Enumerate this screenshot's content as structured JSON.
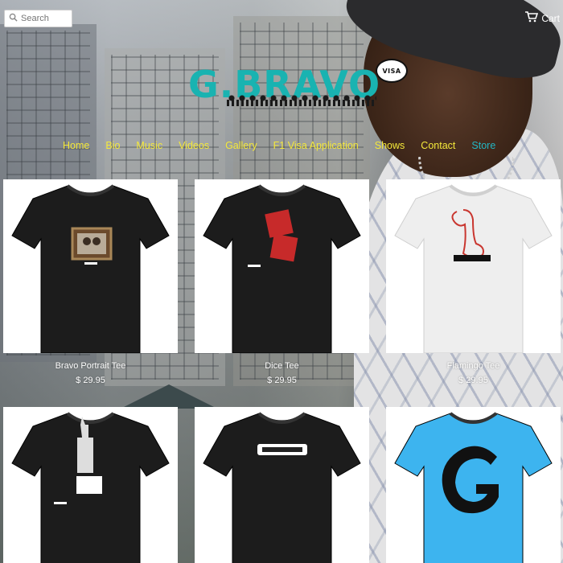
{
  "header": {
    "search_placeholder": "Search",
    "cart_label": "Cart",
    "logo_text": "G.BRAVO",
    "badge_text": "VISA"
  },
  "nav": [
    {
      "label": "Home"
    },
    {
      "label": "Bio"
    },
    {
      "label": "Music"
    },
    {
      "label": "Videos"
    },
    {
      "label": "Gallery"
    },
    {
      "label": "F1 Visa Application"
    },
    {
      "label": "Shows"
    },
    {
      "label": "Contact"
    },
    {
      "label": "Store",
      "active": true
    }
  ],
  "products": [
    {
      "name": "Bravo Portrait Tee",
      "price": "$ 29.95",
      "shirt_color": "#1c1c1c",
      "design": "portrait"
    },
    {
      "name": "Dice Tee",
      "price": "$ 29.95",
      "shirt_color": "#1c1c1c",
      "design": "dice"
    },
    {
      "name": "Flamingo Tee",
      "price": "$ 29.95",
      "shirt_color": "#eeeeee",
      "design": "flamingo"
    },
    {
      "shirt_color": "#1c1c1c",
      "design": "liberty"
    },
    {
      "shirt_color": "#1c1c1c",
      "design": "rude-boy-era"
    },
    {
      "shirt_color": "#3db4ef",
      "design": "g-letter"
    }
  ],
  "colors": {
    "nav_link": "#f4e83a",
    "nav_active": "#22b7c4",
    "logo": "#19b3b1"
  }
}
